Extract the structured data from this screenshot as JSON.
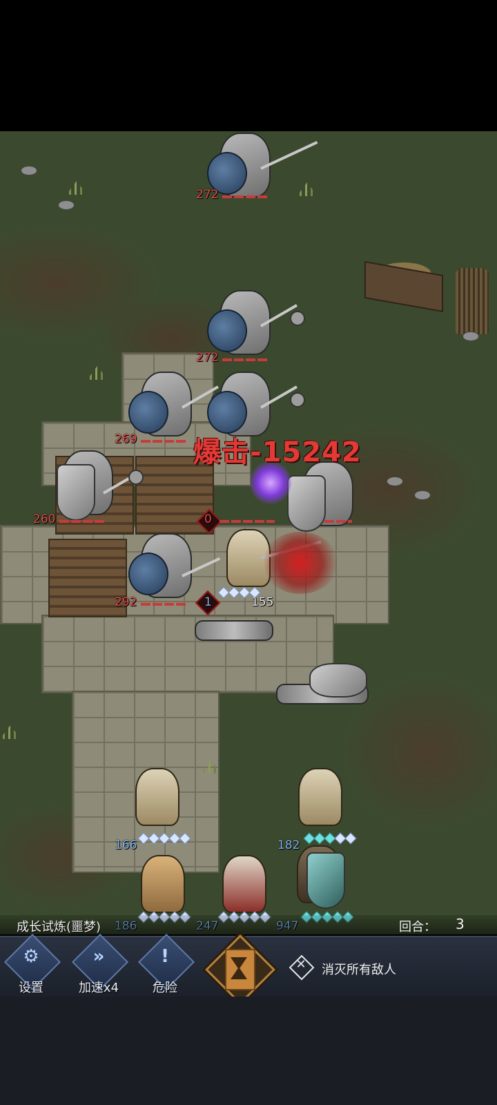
{
  "enemies": [
    {
      "hp": "272"
    },
    {
      "hp": "272"
    },
    {
      "hp": "269"
    },
    {
      "hp": "260"
    },
    {
      "hp": "0"
    },
    {
      "hp": "292"
    }
  ],
  "active_hero": {
    "level": "1",
    "hp": "155"
  },
  "heroes": [
    {
      "hp": "166"
    },
    {
      "hp": "182"
    },
    {
      "hp": "186"
    },
    {
      "hp": "247"
    },
    {
      "hp": "947"
    }
  ],
  "floating_text": {
    "crit": "爆击-15242"
  },
  "hud": {
    "mode_name": "成长试炼(噩梦)",
    "round_label": "回合：",
    "round_value": "3",
    "settings_label": "设置",
    "speed_label": "加速x4",
    "danger_label": "危险",
    "objective_text": "消灭所有敌人"
  },
  "colors": {
    "enemy_hp": "#e14b4b",
    "hero_hp": "#7fb2e8",
    "crit_text": "#e33a36",
    "hud_bg": "#1b2029"
  },
  "icons": [
    "gear-icon",
    "fast-forward-icon",
    "exclamation-icon",
    "hourglass-icon",
    "crossed-swords-icon"
  ]
}
